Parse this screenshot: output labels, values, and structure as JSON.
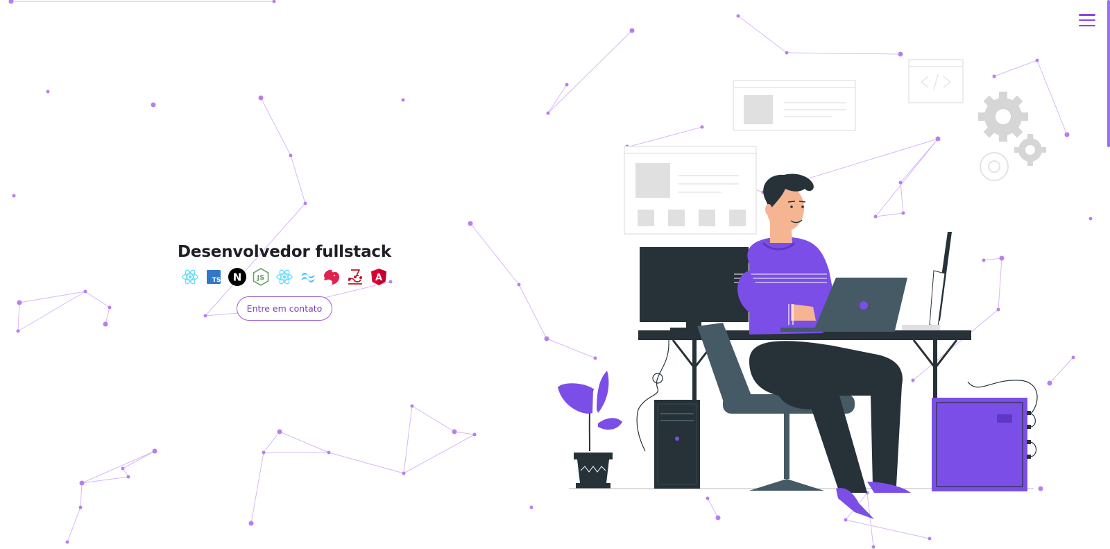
{
  "hero": {
    "title": "Desenvolvedor fullstack",
    "contact_button": "Entre em contato"
  },
  "tech_icons": [
    {
      "name": "react-icon",
      "color": "#61dafb"
    },
    {
      "name": "typescript-icon",
      "color": "#3178c6",
      "text": "TS"
    },
    {
      "name": "nextjs-icon",
      "color": "#000000",
      "text": "N"
    },
    {
      "name": "nodejs-icon",
      "color": "#68a063",
      "text": "JS"
    },
    {
      "name": "react-native-icon",
      "color": "#61dafb"
    },
    {
      "name": "tailwindcss-icon",
      "color": "#38bdf8"
    },
    {
      "name": "nestjs-icon",
      "color": "#e0234e"
    },
    {
      "name": "jest-icon",
      "color": "#c21325"
    },
    {
      "name": "angular-icon",
      "color": "#dd0031",
      "text": "A"
    }
  ],
  "colors": {
    "accent": "#8e44e0",
    "particle": "#b77ef0",
    "illustration_purple": "#7b4ee8",
    "illustration_dark": "#263238"
  },
  "icons": {
    "menu": "hamburger-menu-icon"
  }
}
